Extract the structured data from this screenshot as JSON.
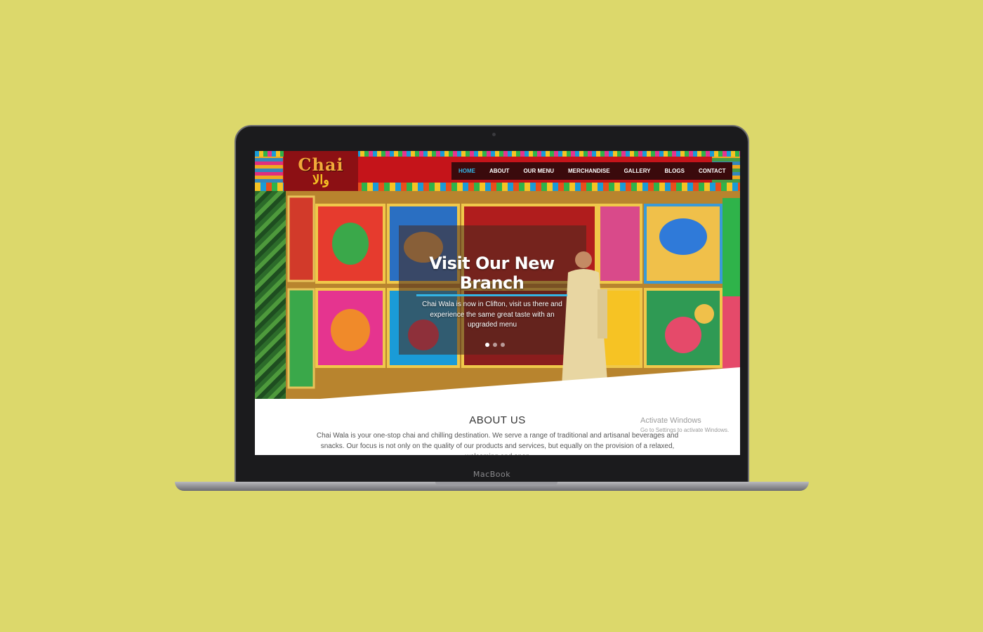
{
  "site": {
    "logo": {
      "main": "Chai",
      "sub": "والا"
    },
    "nav": [
      {
        "label": "HOME",
        "active": true
      },
      {
        "label": "ABOUT",
        "active": false
      },
      {
        "label": "OUR MENU",
        "active": false
      },
      {
        "label": "MERCHANDISE",
        "active": false
      },
      {
        "label": "GALLERY",
        "active": false
      },
      {
        "label": "BLOGS",
        "active": false
      },
      {
        "label": "CONTACT",
        "active": false
      }
    ],
    "hero": {
      "title": "Visit Our New Branch",
      "text": "Chai Wala is now in Clifton, visit us there and experience the same great taste with an upgraded menu",
      "slides_count": 3,
      "active_slide": 1
    },
    "about": {
      "title": "ABOUT US",
      "text": "Chai Wala is your one-stop chai and chilling destination. We serve a range of traditional and artisanal beverages and snacks. Our focus is not only on the quality of our products and services, but equally on the provision of a relaxed, welcoming and open"
    },
    "watermark": {
      "title": "Activate Windows",
      "subtitle": "Go to Settings to activate Windows."
    }
  },
  "device": {
    "label": "MacBook"
  },
  "colors": {
    "background": "#dcd86b",
    "header_red": "#c5141a",
    "accent_blue": "#33b5e5",
    "logo_orange": "#f3a93a"
  }
}
